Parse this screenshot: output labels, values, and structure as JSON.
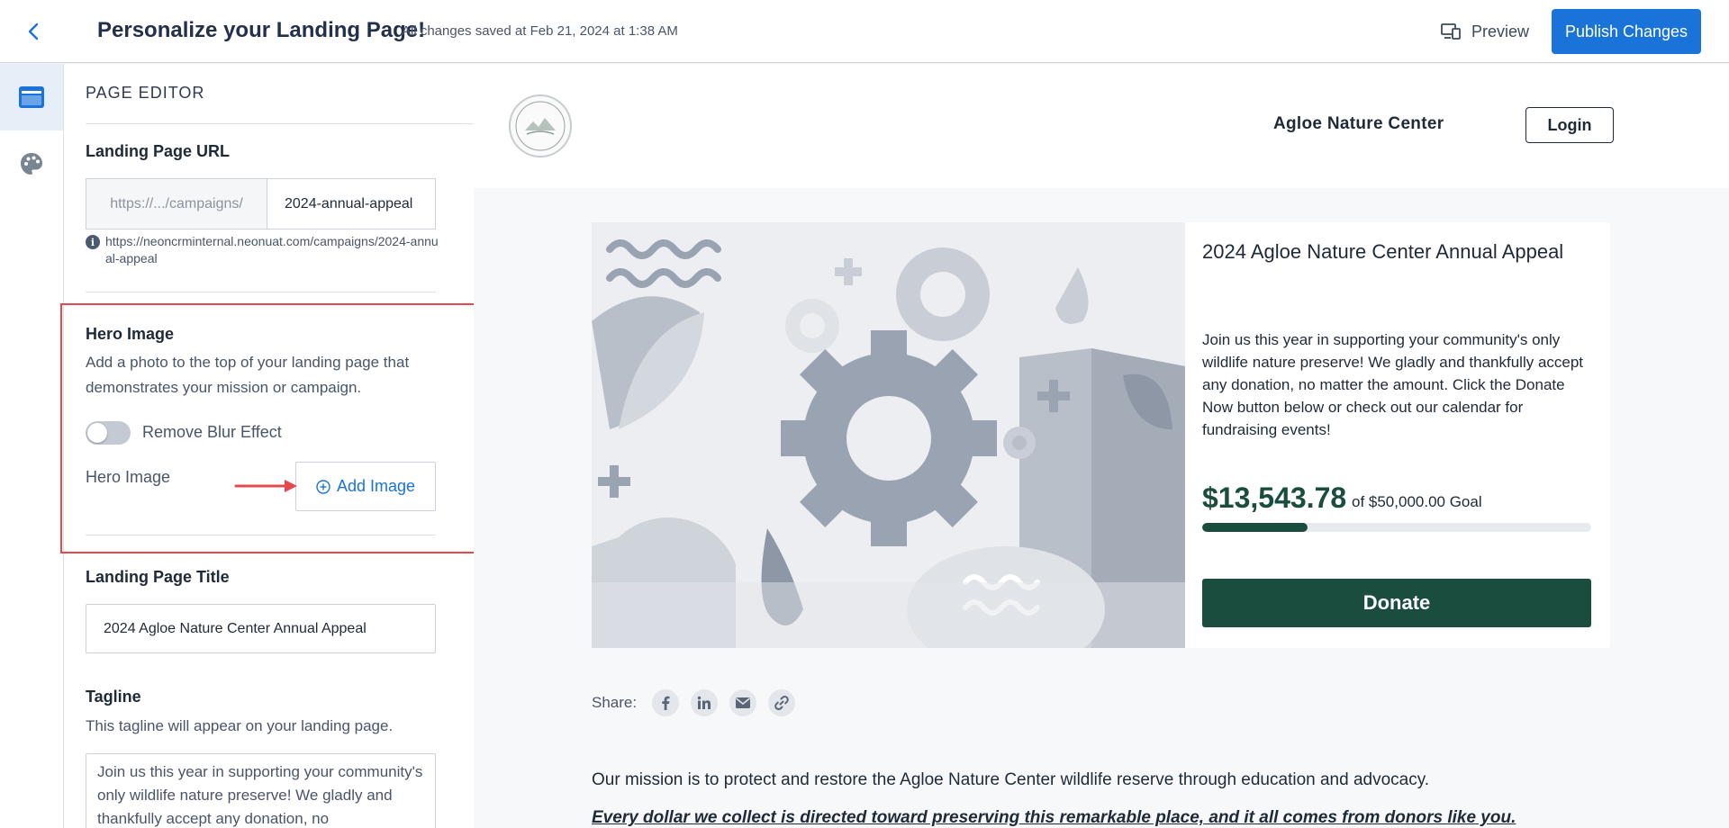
{
  "topbar": {
    "title": "Personalize your Landing Page!",
    "saved_status": "All changes saved at Feb 21, 2024 at 1:38 AM",
    "preview_label": "Preview",
    "publish_label": "Publish Changes"
  },
  "rail": {
    "items": [
      {
        "icon": "page-editor-icon",
        "active": true
      },
      {
        "icon": "palette-icon",
        "active": false
      }
    ]
  },
  "editor": {
    "heading": "PAGE EDITOR",
    "url": {
      "label": "Landing Page URL",
      "prefix": "https://.../campaigns/",
      "slug": "2024-annual-appeal",
      "full_url": "https://neoncrminternal.neonuat.com/campaigns/2024-annual-appeal"
    },
    "hero": {
      "label": "Hero Image",
      "description": "Add a photo to the top of your landing page that demonstrates your mission or campaign.",
      "toggle_label": "Remove Blur Effect",
      "toggle_on": false,
      "image_label": "Hero Image",
      "add_image_label": "Add Image"
    },
    "title": {
      "label": "Landing Page Title",
      "value": "2024 Agloe Nature Center Annual Appeal"
    },
    "tagline": {
      "label": "Tagline",
      "description": "This tagline will appear on your landing page.",
      "value": "Join us this year in supporting your community's only wildlife nature preserve! We gladly and thankfully accept any donation, no"
    }
  },
  "preview": {
    "org_name": "Agloe Nature Center",
    "login_label": "Login",
    "campaign_title": "2024 Agloe Nature Center Annual Appeal",
    "tagline": "Join us this year in supporting your community's only wildlife nature preserve! We gladly and thankfully accept any donation, no matter the amount. Click the Donate Now button below or check out our calendar for fundraising events!",
    "amount_raised": "$13,543.78",
    "goal_text": "of $50,000.00 Goal",
    "progress_fraction": 0.27,
    "donate_label": "Donate",
    "share_label": "Share:",
    "share_icons": [
      "facebook-icon",
      "linkedin-icon",
      "email-icon",
      "link-icon"
    ],
    "mission": "Our mission is to protect and restore the Agloe Nature Center wildlife reserve through education and advocacy.",
    "italic_line": "Every dollar we collect is directed toward preserving this remarkable place, and it all comes from donors like you."
  },
  "colors": {
    "accent": "#1a73d9",
    "brand_green": "#1a4d3e",
    "highlight": "#e5484d"
  }
}
